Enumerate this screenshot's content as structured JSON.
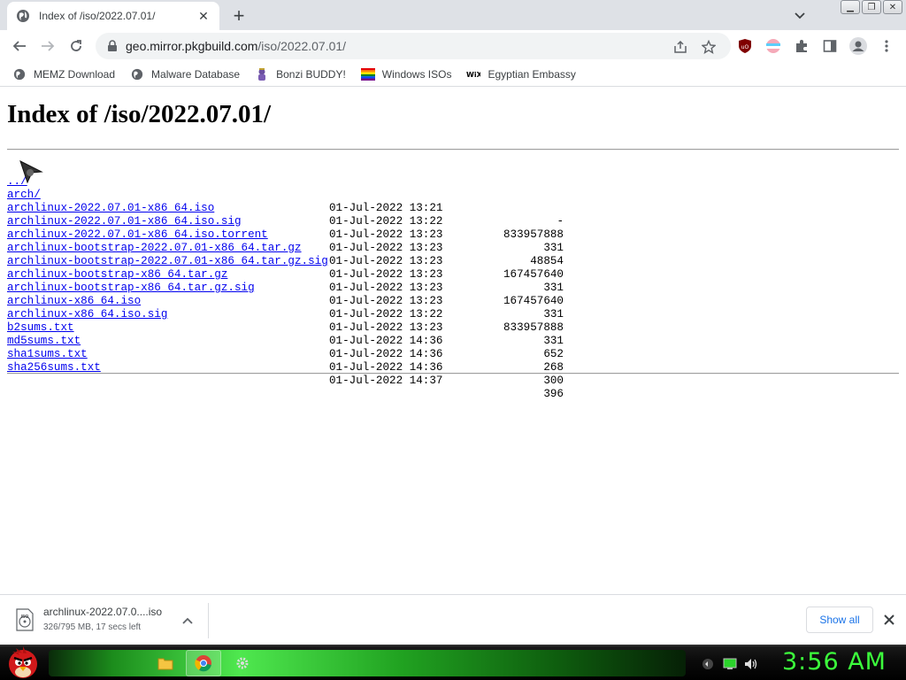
{
  "browser": {
    "tab": {
      "title": "Index of /iso/2022.07.01/"
    },
    "address": {
      "host": "geo.mirror.pkgbuild.com",
      "path": "/iso/2022.07.01/"
    },
    "bookmarks": [
      {
        "label": "MEMZ Download",
        "icon": "globe-icon"
      },
      {
        "label": "Malware Database",
        "icon": "globe-icon"
      },
      {
        "label": "Bonzi BUDDY!",
        "icon": "bonzi-icon"
      },
      {
        "label": "Windows ISOs",
        "icon": "rainbow-flag-icon"
      },
      {
        "label": "Egyptian Embassy",
        "icon": "wix-icon"
      }
    ]
  },
  "page": {
    "heading": "Index of /iso/2022.07.01/",
    "parent_link": "../",
    "entries": [
      {
        "name": "arch/",
        "date": "01-Jul-2022 13:21",
        "size": "-"
      },
      {
        "name": "archlinux-2022.07.01-x86_64.iso",
        "date": "01-Jul-2022 13:22",
        "size": "833957888"
      },
      {
        "name": "archlinux-2022.07.01-x86_64.iso.sig",
        "date": "01-Jul-2022 13:23",
        "size": "331"
      },
      {
        "name": "archlinux-2022.07.01-x86_64.iso.torrent",
        "date": "01-Jul-2022 13:23",
        "size": "48854"
      },
      {
        "name": "archlinux-bootstrap-2022.07.01-x86_64.tar.gz",
        "date": "01-Jul-2022 13:23",
        "size": "167457640"
      },
      {
        "name": "archlinux-bootstrap-2022.07.01-x86_64.tar.gz.sig",
        "date": "01-Jul-2022 13:23",
        "size": "331"
      },
      {
        "name": "archlinux-bootstrap-x86_64.tar.gz",
        "date": "01-Jul-2022 13:23",
        "size": "167457640"
      },
      {
        "name": "archlinux-bootstrap-x86_64.tar.gz.sig",
        "date": "01-Jul-2022 13:23",
        "size": "331"
      },
      {
        "name": "archlinux-x86_64.iso",
        "date": "01-Jul-2022 13:22",
        "size": "833957888"
      },
      {
        "name": "archlinux-x86_64.iso.sig",
        "date": "01-Jul-2022 13:23",
        "size": "331"
      },
      {
        "name": "b2sums.txt",
        "date": "01-Jul-2022 14:36",
        "size": "652"
      },
      {
        "name": "md5sums.txt",
        "date": "01-Jul-2022 14:36",
        "size": "268"
      },
      {
        "name": "sha1sums.txt",
        "date": "01-Jul-2022 14:36",
        "size": "300"
      },
      {
        "name": "sha256sums.txt",
        "date": "01-Jul-2022 14:37",
        "size": "396"
      }
    ]
  },
  "download": {
    "filename": "archlinux-2022.07.0....iso",
    "file_icon_label": "ISO",
    "status": "326/795 MB, 17 secs left",
    "show_all": "Show all"
  },
  "taskbar": {
    "clock": "3:56 AM"
  },
  "colors": {
    "link": "#0000ee",
    "clock": "#3cff3c",
    "accent": "#1a73e8"
  }
}
